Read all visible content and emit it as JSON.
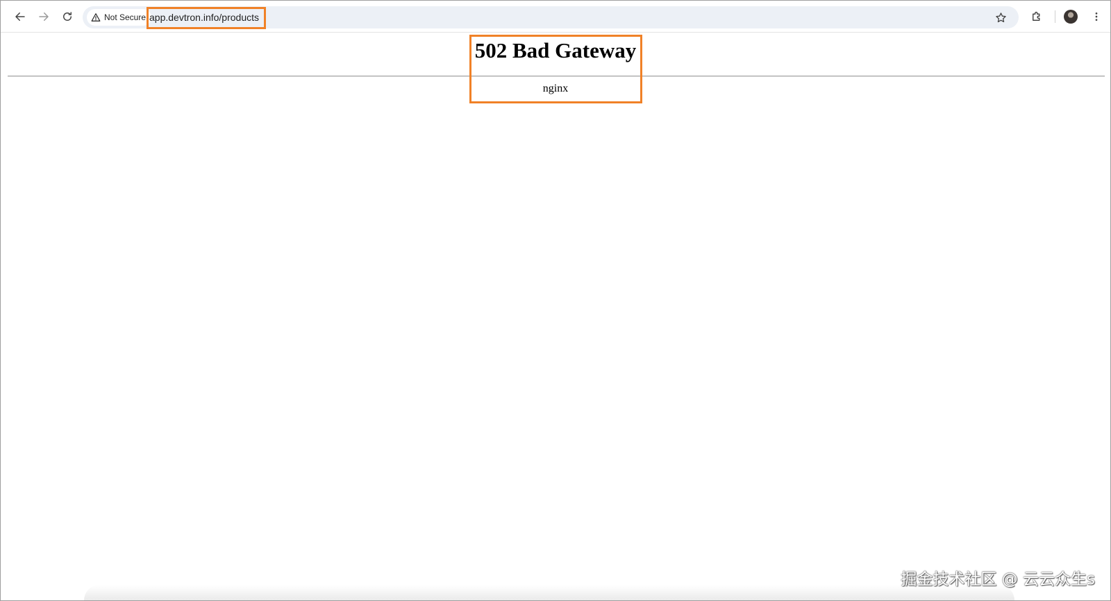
{
  "browser": {
    "security_label": "Not Secure",
    "url": "app.devtron.info/products",
    "icons": {
      "back": "arrow-left-icon",
      "forward": "arrow-right-icon",
      "reload": "reload-icon",
      "security": "warning-triangle-icon",
      "bookmark": "star-icon",
      "extensions": "puzzle-icon",
      "profile": "avatar",
      "menu": "kebab-menu-icon"
    },
    "highlight_color": "#f08127"
  },
  "page": {
    "title": "502 Bad Gateway",
    "server": "nginx"
  },
  "watermark": "掘金技术社区 @ 云云众生s"
}
